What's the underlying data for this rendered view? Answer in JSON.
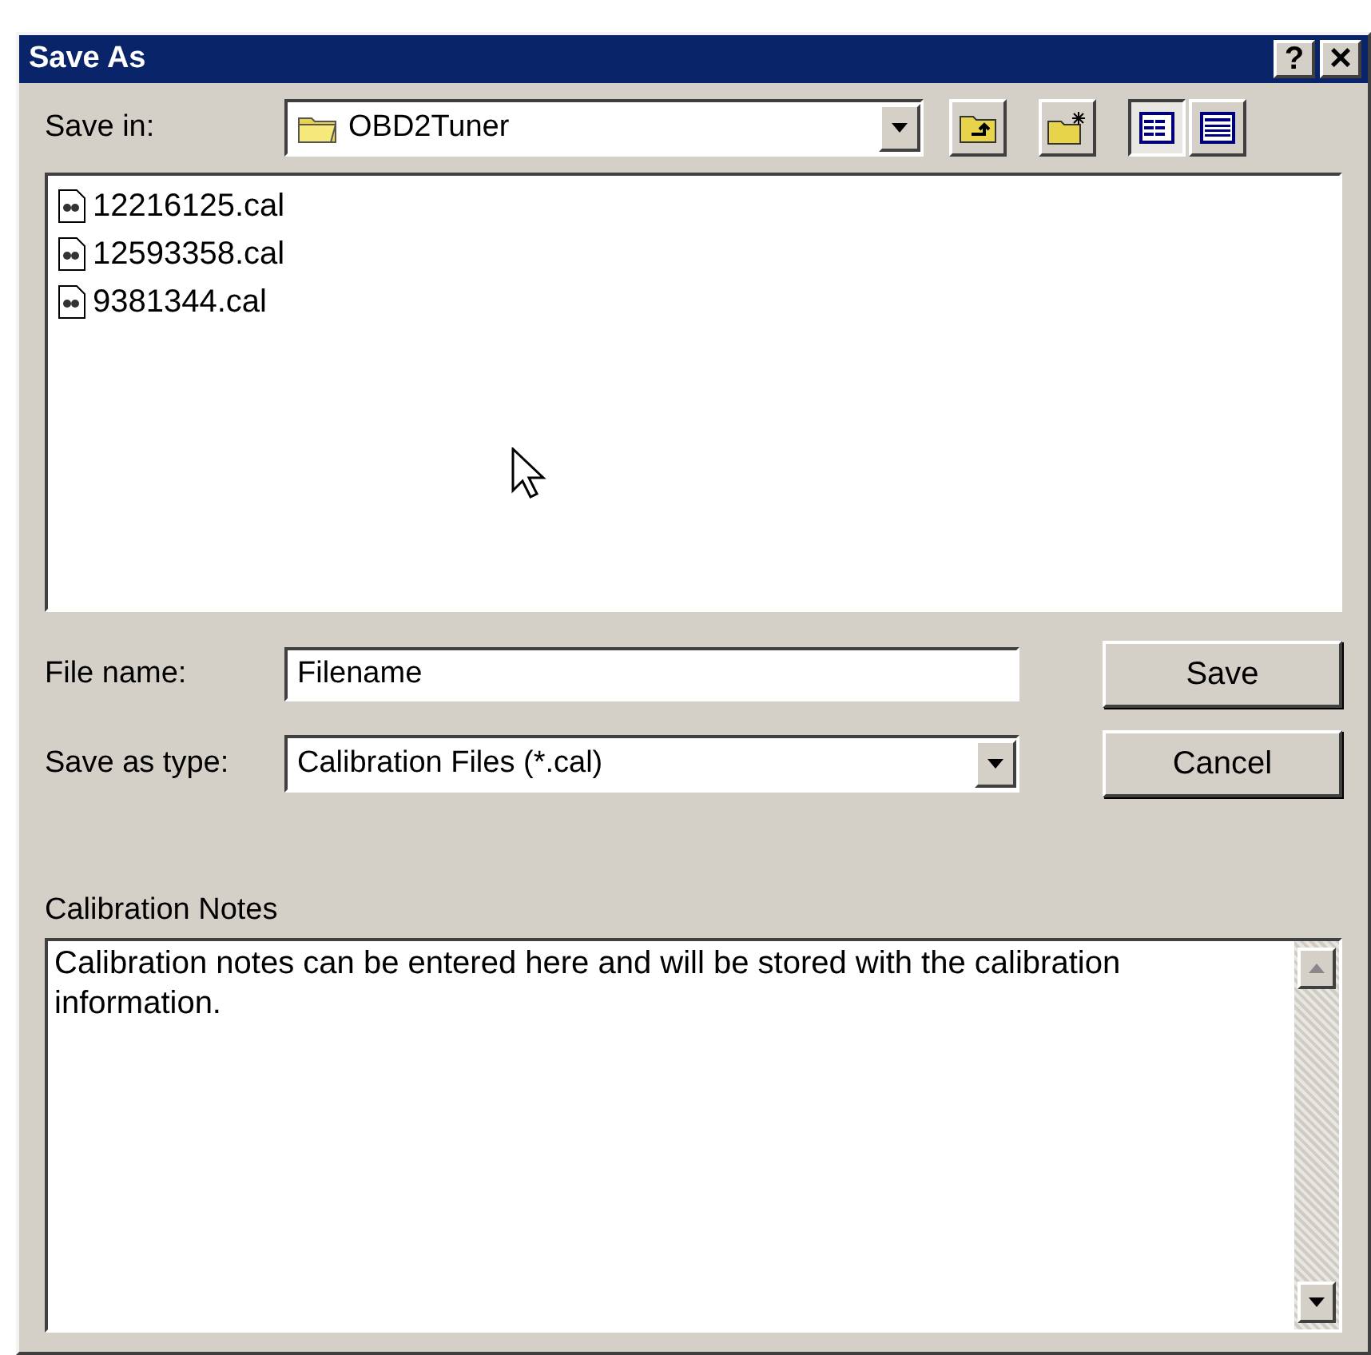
{
  "window": {
    "title": "Save As",
    "buttons": [
      {
        "kind": "help",
        "label": "?"
      },
      {
        "kind": "close",
        "label": "×"
      }
    ]
  },
  "save_in": {
    "label": "Save in:",
    "value": "OBD2Tuner"
  },
  "toolbar": [
    {
      "kind": "up",
      "selected": false
    },
    {
      "kind": "new-folder",
      "selected": false
    },
    {
      "kind": "list-view",
      "selected": true
    },
    {
      "kind": "details-view",
      "selected": false
    }
  ],
  "files": [
    {
      "name": "12216125.cal"
    },
    {
      "name": "12593358.cal"
    },
    {
      "name": "9381344.cal"
    }
  ],
  "file_name": {
    "label": "File name:",
    "value": "Filename"
  },
  "save_as_type": {
    "label": "Save as type:",
    "value": "Calibration Files (*.cal)"
  },
  "actions": [
    {
      "label": "Save"
    },
    {
      "label": "Cancel"
    }
  ],
  "notes": {
    "label": "Calibration Notes",
    "value": "Calibration notes can be entered here and will be stored with the calibration information."
  }
}
